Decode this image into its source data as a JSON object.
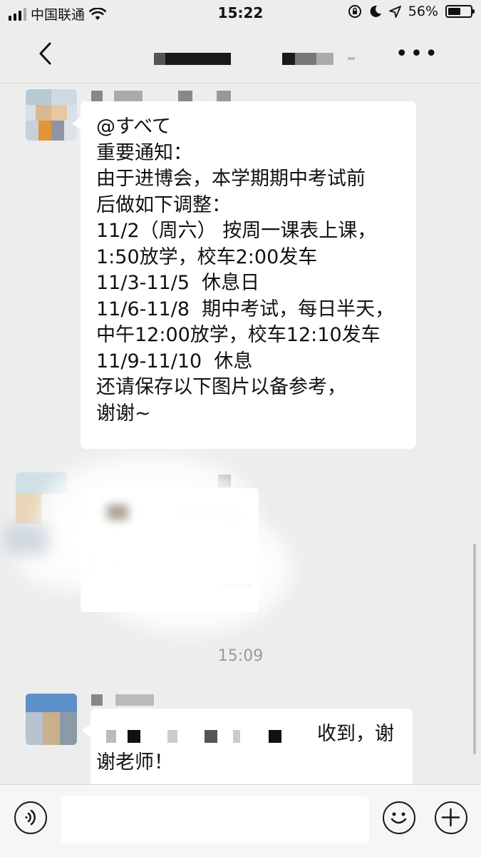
{
  "status_bar": {
    "carrier": "中国联通",
    "time": "15:22",
    "battery_percent": "56%",
    "battery_level": 0.56,
    "icons": [
      "signal-icon",
      "wifi-icon",
      "rotation-lock-icon",
      "moon-icon",
      "location-arrow-icon",
      "battery-icon"
    ]
  },
  "nav": {
    "icons": [
      "back-arrow-icon",
      "more-dots-icon"
    ]
  },
  "messages": {
    "first": {
      "lines": [
        "@すべて",
        "重要通知：",
        "由于进博会，本学期期中考试前",
        "后做如下调整：",
        "11/2（周六） 按周一课表上课，",
        "1:50放学，校车2:00发车",
        "11/3-11/5  休息日",
        "11/6-11/8  期中考试，每日半天，",
        "中午12:00放学，校车12:10发车",
        "11/9-11/10  休息",
        "还请保存以下图片以备参考，",
        "谢谢~"
      ]
    },
    "timestamp": "15:09",
    "reply": {
      "line1": "收到，谢",
      "line2": "谢老师！"
    }
  },
  "input_bar": {
    "icons": [
      "voice-icon",
      "emoji-icon",
      "plus-icon"
    ]
  },
  "colors": {
    "background": "#ededed",
    "bubble": "#ffffff",
    "input_bar": "#f6f6f6"
  }
}
